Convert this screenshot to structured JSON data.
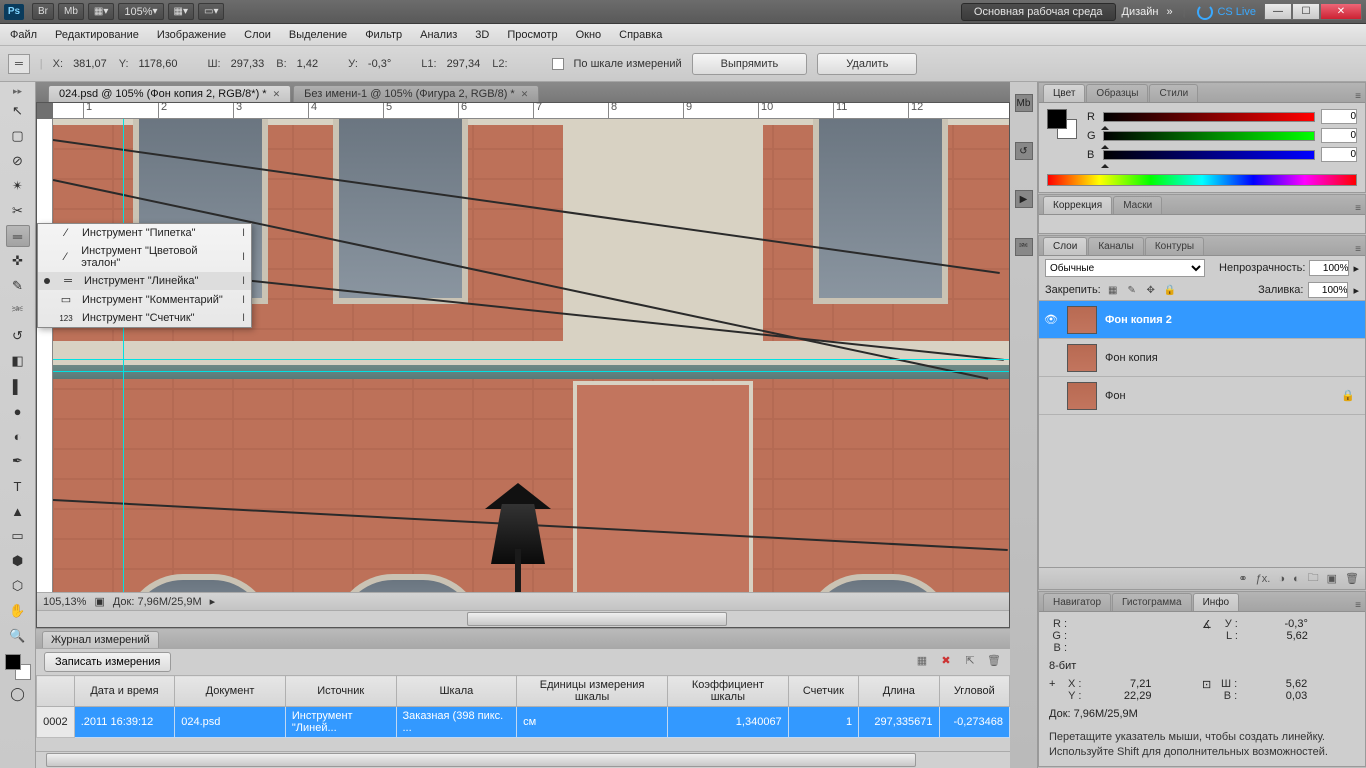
{
  "appbar": {
    "zoom": "105%",
    "workspace_primary": "Основная рабочая среда",
    "workspace_secondary": "Дизайн",
    "cs_live": "CS Live"
  },
  "menu": [
    "Файл",
    "Редактирование",
    "Изображение",
    "Слои",
    "Выделение",
    "Фильтр",
    "Анализ",
    "3D",
    "Просмотр",
    "Окно",
    "Справка"
  ],
  "options": {
    "x_label": "X:",
    "x": "381,07",
    "y_label": "Y:",
    "y": "1178,60",
    "w_label": "Ш:",
    "w": "297,33",
    "h_label": "В:",
    "h": "1,42",
    "a_label": "У:",
    "a": "-0,3°",
    "l1_label": "L1:",
    "l1": "297,34",
    "l2_label": "L2:",
    "l2": "",
    "scale_chk": "По шкале измерений",
    "straighten": "Выпрямить",
    "delete": "Удалить"
  },
  "tabs": [
    {
      "label": "024.psd @ 105% (Фон копия 2, RGB/8*) *",
      "active": true
    },
    {
      "label": "Без имени-1 @ 105% (Фигура 2, RGB/8) *",
      "active": false
    }
  ],
  "ruler_marks": [
    "1",
    "2",
    "3",
    "4",
    "5",
    "6",
    "7",
    "8",
    "9",
    "10",
    "11",
    "12"
  ],
  "flyout": [
    {
      "icon": "⁄",
      "label": "Инструмент \"Пипетка\"",
      "key": "I",
      "sel": false
    },
    {
      "icon": "⁄",
      "label": "Инструмент \"Цветовой эталон\"",
      "key": "I",
      "sel": false
    },
    {
      "icon": "═",
      "label": "Инструмент \"Линейка\"",
      "key": "I",
      "sel": true
    },
    {
      "icon": "▭",
      "label": "Инструмент \"Комментарий\"",
      "key": "I",
      "sel": false
    },
    {
      "icon": "123",
      "label": "Инструмент \"Счетчик\"",
      "key": "I",
      "sel": false
    }
  ],
  "status": {
    "zoom": "105,13%",
    "doc": "Док: 7,96M/25,9M"
  },
  "mlog": {
    "title": "Журнал измерений",
    "record": "Записать измерения",
    "cols": [
      "",
      "Дата и время",
      "Документ",
      "Источник",
      "Шкала",
      "Единицы измерения шкалы",
      "Коэффициент шкалы",
      "Счетчик",
      "Длина",
      "Угловой"
    ],
    "row": {
      "n": "0002",
      "date": ".2011 16:39:12",
      "doc": "024.psd",
      "src": "Инструмент \"Линей...",
      "scale": "Заказная (398 пикс. ...",
      "units": "см",
      "coef": "1,340067",
      "count": "1",
      "len": "297,335671",
      "ang": "-0,273468"
    }
  },
  "panels": {
    "color": {
      "tabs": [
        "Цвет",
        "Образцы",
        "Стили"
      ],
      "r": "0",
      "g": "0",
      "b": "0"
    },
    "adjust": {
      "tabs": [
        "Коррекция",
        "Маски"
      ]
    },
    "layers": {
      "tabs": [
        "Слои",
        "Каналы",
        "Контуры"
      ],
      "blend": "Обычные",
      "opacity_label": "Непрозрачность:",
      "opacity": "100%",
      "lock_label": "Закрепить:",
      "fill_label": "Заливка:",
      "fill": "100%",
      "items": [
        {
          "name": "Фон копия 2",
          "sel": true,
          "eye": true,
          "lock": false
        },
        {
          "name": "Фон копия",
          "sel": false,
          "eye": false,
          "lock": false
        },
        {
          "name": "Фон",
          "sel": false,
          "eye": false,
          "lock": true
        }
      ]
    },
    "info": {
      "tabs": [
        "Навигатор",
        "Гистограмма",
        "Инфо"
      ],
      "rgb": {
        "R": "",
        "G": "",
        "B": ""
      },
      "angle_label": "У :",
      "angle": "-0,3°",
      "l_label": "L :",
      "l": "5,62",
      "bits": "8-бит",
      "x_label": "X :",
      "x": "7,21",
      "y_label": "Y :",
      "y": "22,29",
      "w_label": "Ш :",
      "w": "5,62",
      "h_label": "В :",
      "h": "0,03",
      "docsize": "Док: 7,96M/25,9M",
      "hint1": "Перетащите указатель мыши, чтобы создать линейку.",
      "hint2": "Используйте Shift для дополнительных возможностей."
    }
  }
}
